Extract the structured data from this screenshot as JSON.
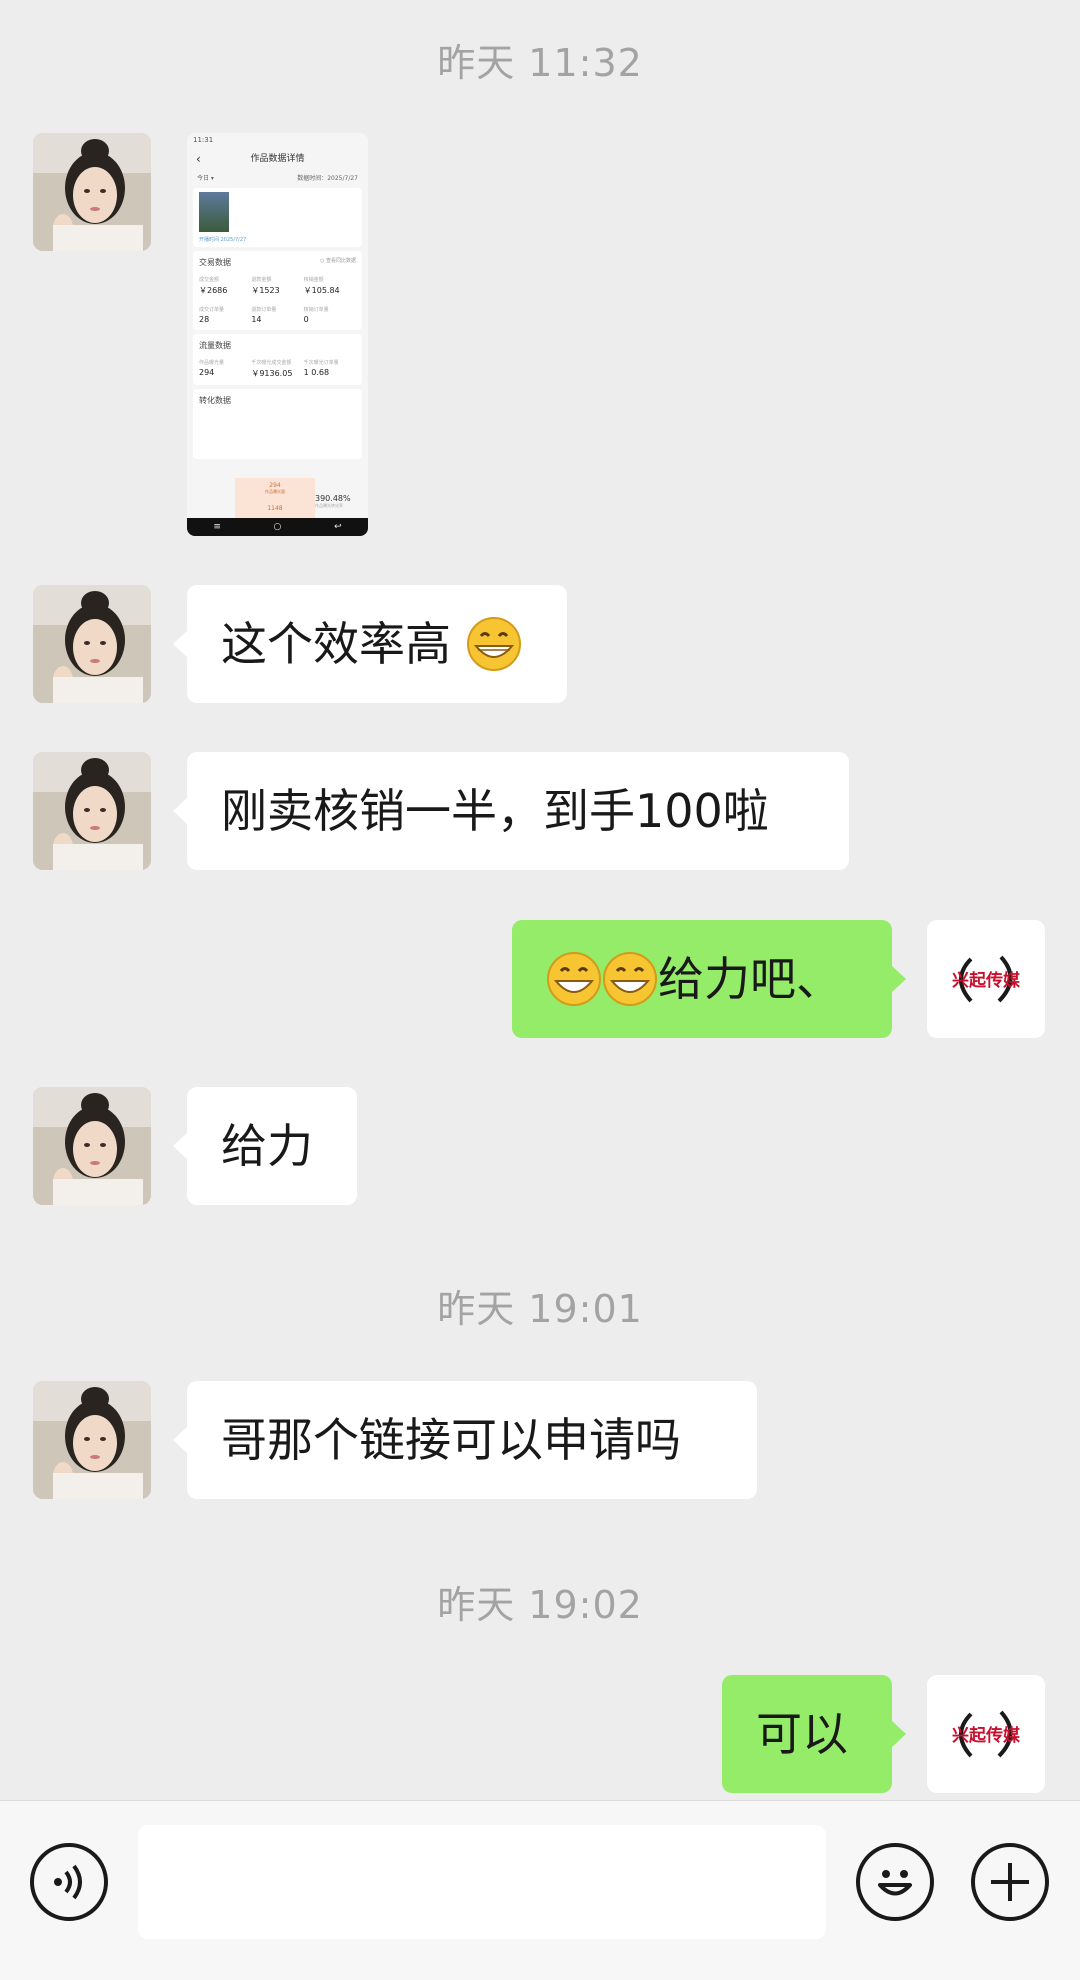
{
  "timestamps": [
    "昨天 11:32",
    "昨天 19:01",
    "昨天 19:02"
  ],
  "messages": [
    {
      "from": "other",
      "type": "image"
    },
    {
      "from": "other",
      "text": "这个效率高",
      "emoji": "grinning-face"
    },
    {
      "from": "other",
      "text": "刚卖核销一半，到手100啦"
    },
    {
      "from": "me",
      "text": "给力吧、",
      "emoji_prefix": [
        "grinning-face",
        "grinning-face"
      ]
    },
    {
      "from": "other",
      "text": "给力"
    },
    {
      "from": "other",
      "text": "哥那个链接可以申请吗"
    },
    {
      "from": "me",
      "text": "可以"
    }
  ],
  "my_avatar_text": "兴起传媒",
  "screenshot": {
    "status_time": "11:31",
    "title": "作品数据详情",
    "filter": "今日 ▾",
    "update_time": "数据时间：2025/7/27",
    "date_line": "开播时间 2025/7/27",
    "trade_title": "交易数据",
    "trade_toggle": "○ 查看同比数据",
    "trade": [
      {
        "label": "成交金额",
        "value": "￥2686"
      },
      {
        "label": "退款金额",
        "value": "￥1523"
      },
      {
        "label": "核销金额",
        "value": "￥105.84"
      },
      {
        "label": "成交订单量",
        "value": "28"
      },
      {
        "label": "退款订单量",
        "value": "14"
      },
      {
        "label": "核销订单量",
        "value": "0"
      }
    ],
    "traffic_title": "流量数据",
    "traffic": [
      {
        "label": "作品曝光量",
        "value": "294"
      },
      {
        "label": "千次曝光成交金额",
        "value": "￥9136.05"
      },
      {
        "label": "千次曝光订单量",
        "value": "1 0.68"
      }
    ],
    "conv_title": "转化数据",
    "funnel_value": "294",
    "funnel_label": "作品曝光量",
    "funnel_bottom": "1148",
    "conv_pct": "390.48%",
    "conv_pct_label": "作品曝光转化率"
  },
  "colors": {
    "bg": "#ededed",
    "bubble_in": "#ffffff",
    "bubble_out": "#95ec69",
    "timestamp": "#a3a3a3"
  }
}
